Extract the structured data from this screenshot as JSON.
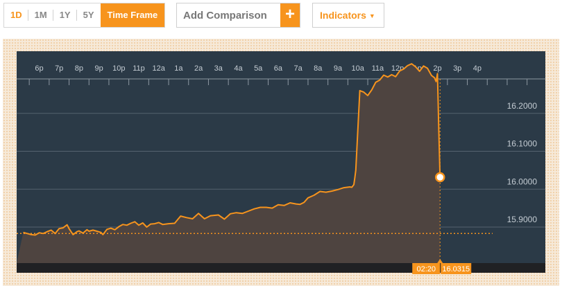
{
  "toolbar": {
    "ranges": [
      {
        "label": "1D",
        "active": true
      },
      {
        "label": "1M",
        "active": false
      },
      {
        "label": "1Y",
        "active": false
      },
      {
        "label": "5Y",
        "active": false
      }
    ],
    "time_frame_label": "Time Frame",
    "comparison_placeholder": "Add Comparison",
    "add_label": "+",
    "indicators_label": "Indicators",
    "indicators_caret": "▼"
  },
  "colors": {
    "accent": "#f7941d",
    "chart_background": "#2b3a47",
    "area_fill": "#4e4440",
    "axis_strip": "#202124",
    "gridline": "#55636f",
    "axis_text": "#c4ccd3"
  },
  "crosshair": {
    "time_label": "02:20",
    "value_label": "16.0315"
  },
  "chart_data": {
    "type": "area",
    "title": "",
    "xlabel": "",
    "ylabel": "",
    "x_tick_labels": [
      "6p",
      "7p",
      "8p",
      "9p",
      "10p",
      "11p",
      "12a",
      "1a",
      "2a",
      "3a",
      "4a",
      "5a",
      "6a",
      "7a",
      "8a",
      "9a",
      "10a",
      "11a",
      "12p",
      "1p",
      "2p",
      "3p",
      "4p"
    ],
    "y_tick_labels": [
      "16.2000",
      "16.1000",
      "16.0000",
      "15.9000"
    ],
    "y_ticks": [
      16.2,
      16.1,
      16.0,
      15.9
    ],
    "ylim": [
      15.805,
      16.364
    ],
    "grid": true,
    "previous_close": 15.883,
    "series": [
      {
        "x_hours_since_6p": [
          -0.8,
          -0.6,
          -0.4,
          -0.2,
          0,
          0.2,
          0.4,
          0.6,
          0.8,
          1.0,
          1.2,
          1.4,
          1.5,
          1.7,
          1.9,
          2.0,
          2.2,
          2.4,
          2.5,
          2.7,
          2.9,
          3.1,
          3.2,
          3.4,
          3.6,
          3.8,
          4.0,
          4.2,
          4.4,
          4.6,
          4.8,
          5.0,
          5.2,
          5.4,
          5.6,
          5.8,
          6.0,
          6.2,
          6.5,
          6.8,
          7.1,
          7.4,
          7.7,
          8.0,
          8.3,
          8.6,
          9.0,
          9.3,
          9.6,
          9.9,
          10.2,
          10.5,
          10.8,
          11.1,
          11.4,
          11.7,
          12.0,
          12.3,
          12.6,
          12.9,
          13.1,
          13.3,
          13.5,
          13.8,
          14.1,
          14.4,
          14.7,
          15.0,
          15.3,
          15.6,
          15.7,
          15.8,
          15.85,
          15.9,
          16.1,
          16.3,
          16.5,
          16.7,
          16.9,
          17.1,
          17.3,
          17.5,
          17.7,
          17.9,
          18.1,
          18.3,
          18.5,
          18.7,
          18.9,
          19.1,
          19.3,
          19.5,
          19.7,
          19.85,
          19.93,
          20.0,
          20.07,
          20.13
        ],
        "values": [
          15.886,
          15.883,
          15.88,
          15.879,
          15.885,
          15.883,
          15.888,
          15.892,
          15.883,
          15.896,
          15.898,
          15.906,
          15.896,
          15.88,
          15.888,
          15.89,
          15.884,
          15.893,
          15.889,
          15.892,
          15.889,
          15.886,
          15.88,
          15.894,
          15.897,
          15.893,
          15.901,
          15.907,
          15.905,
          15.91,
          15.914,
          15.905,
          15.911,
          15.9,
          15.908,
          15.909,
          15.912,
          15.907,
          15.909,
          15.91,
          15.929,
          15.925,
          15.922,
          15.936,
          15.922,
          15.93,
          15.932,
          15.921,
          15.935,
          15.938,
          15.936,
          15.942,
          15.948,
          15.952,
          15.952,
          15.95,
          15.959,
          15.957,
          15.964,
          15.961,
          15.96,
          15.965,
          15.977,
          15.984,
          15.994,
          15.992,
          15.995,
          15.999,
          16.004,
          16.006,
          16.005,
          16.012,
          16.03,
          16.05,
          16.26,
          16.256,
          16.247,
          16.262,
          16.282,
          16.288,
          16.301,
          16.296,
          16.302,
          16.297,
          16.312,
          16.317,
          16.326,
          16.331,
          16.323,
          16.311,
          16.325,
          16.319,
          16.3,
          16.294,
          16.284,
          16.305,
          16.15,
          16.0315
        ]
      }
    ]
  }
}
